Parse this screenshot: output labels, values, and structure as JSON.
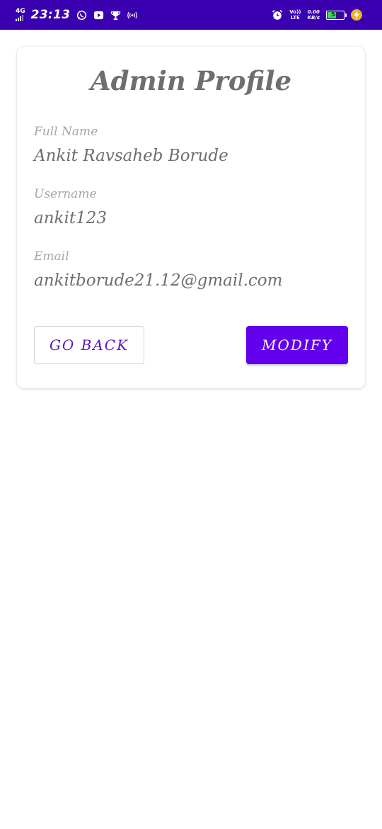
{
  "status_bar": {
    "network": "4G",
    "time": "23:13",
    "volte_top": "Vo))",
    "volte_bottom": "LTE",
    "speed_value": "0.00",
    "speed_unit": "KB/s",
    "battery_level": "55",
    "battery_fraction": 0.55,
    "icons": [
      "signal-icon",
      "whatsapp-icon",
      "youtube-icon",
      "trophy-icon",
      "hotspot-icon",
      "alarm-icon",
      "battery-icon",
      "charging-icon"
    ]
  },
  "profile": {
    "title": "Admin Profile",
    "fields": [
      {
        "label": "Full Name",
        "value": "Ankit Ravsaheb Borude"
      },
      {
        "label": "Username",
        "value": "ankit123"
      },
      {
        "label": "Email",
        "value": "ankitborude21.12@gmail.com"
      }
    ],
    "buttons": {
      "back": "GO BACK",
      "modify": "MODIFY"
    }
  },
  "colors": {
    "status_bar": "#3a00b0",
    "primary": "#6200ee",
    "text": "#6e6e6e",
    "label": "#a6a6a6"
  }
}
